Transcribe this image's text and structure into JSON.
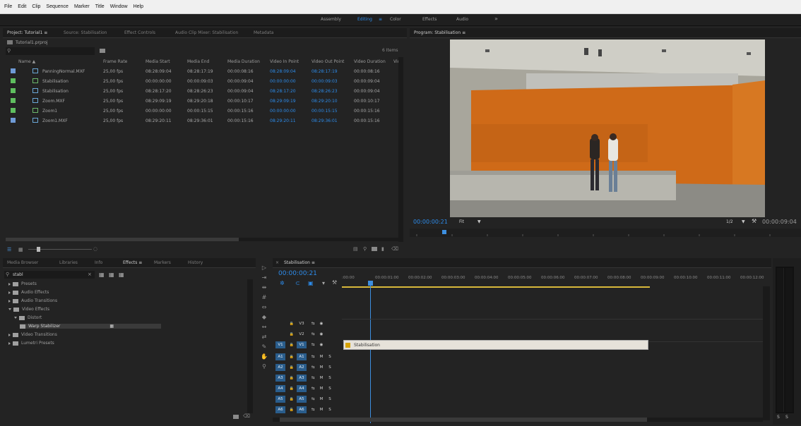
{
  "menu": [
    "File",
    "Edit",
    "Clip",
    "Sequence",
    "Marker",
    "Title",
    "Window",
    "Help"
  ],
  "workspaces": {
    "items": [
      {
        "label": "Assembly"
      },
      {
        "label": "Editing",
        "active": true
      },
      {
        "label": "≡"
      },
      {
        "label": "Color"
      },
      {
        "label": "Effects"
      },
      {
        "label": "Audio"
      },
      {
        "label": "»"
      }
    ]
  },
  "project": {
    "tabs": [
      {
        "label": "Project: Tutorial1  ≡",
        "active": true
      },
      {
        "label": "Source: Stabilisation"
      },
      {
        "label": "Effect Controls"
      },
      {
        "label": "Audio Clip Mixer: Stabilisation"
      },
      {
        "label": "Metadata"
      }
    ],
    "file": "Tutorial1.prproj",
    "item_count": "6 Items",
    "columns": [
      "Name ▲",
      "Frame Rate",
      "Media Start",
      "Media End",
      "Media Duration",
      "Video In Point",
      "Video Out Point",
      "Video Duration",
      "Vide"
    ],
    "rows": [
      {
        "name": "PanningNormal.MXF",
        "type": "seq",
        "swatch": "#6e9ad6",
        "fps": "25,00 fps",
        "start": "08:28:09:04",
        "end": "08:28:17:19",
        "dur": "00:00:08:16",
        "in": "08:28:09:04",
        "out": "08:28:17:19",
        "vdur": "00:00:08:16",
        "extra": "3"
      },
      {
        "name": "Stabilisation",
        "type": "clip",
        "swatch": "#5fbf5f",
        "fps": "25,00 fps",
        "start": "00:00:00:00",
        "end": "00:00:09:03",
        "dur": "00:00:09:04",
        "in": "00:00:00:00",
        "out": "00:00:09:03",
        "vdur": "00:00:09:04",
        "extra": "3"
      },
      {
        "name": "Stabilisation",
        "type": "seq",
        "swatch": "#5fbf5f",
        "fps": "25,00 fps",
        "start": "08:28:17:20",
        "end": "08:28:26:23",
        "dur": "00:00:09:04",
        "in": "08:28:17:20",
        "out": "08:28:26:23",
        "vdur": "00:00:09:04",
        "extra": "3"
      },
      {
        "name": "Zoom.MXF",
        "type": "seq",
        "swatch": "#5fbf5f",
        "fps": "25,00 fps",
        "start": "08:29:09:19",
        "end": "08:29:20:18",
        "dur": "00:00:10:17",
        "in": "08:29:09:19",
        "out": "08:29:20:10",
        "vdur": "00:00:10:17",
        "extra": "3"
      },
      {
        "name": "Zoom1",
        "type": "clip",
        "swatch": "#5fbf5f",
        "fps": "25,00 fps",
        "start": "00:00:00:00",
        "end": "00:00:15:15",
        "dur": "00:00:15:16",
        "in": "00:00:00:00",
        "out": "00:00:15:15",
        "vdur": "00:00:15:16",
        "extra": "3"
      },
      {
        "name": "Zoom1.MXF",
        "type": "seq",
        "swatch": "#6e9ad6",
        "fps": "25,00 fps",
        "start": "08:29:20:11",
        "end": "08:29:36:01",
        "dur": "00:00:15:16",
        "in": "08:29:20:11",
        "out": "08:29:36:01",
        "vdur": "00:00:15:16",
        "extra": "3"
      }
    ]
  },
  "program": {
    "title": "Program: Stabilisation  ≡",
    "timecode": "00:00:00:21",
    "fit": "Fit",
    "resolution": "1/2",
    "duration": "00:00:09:04"
  },
  "effects": {
    "tabs": [
      {
        "label": "Media Browser"
      },
      {
        "label": "Libraries"
      },
      {
        "label": "Info"
      },
      {
        "label": "Effects  ≡",
        "active": true
      },
      {
        "label": "Markers"
      },
      {
        "label": "History"
      }
    ],
    "search": "stabl",
    "tree": [
      {
        "label": "Presets",
        "depth": 0,
        "open": false
      },
      {
        "label": "Audio Effects",
        "depth": 0,
        "open": false
      },
      {
        "label": "Audio Transitions",
        "depth": 0,
        "open": false
      },
      {
        "label": "Video Effects",
        "depth": 0,
        "open": true
      },
      {
        "label": "Distort",
        "depth": 1,
        "open": true
      },
      {
        "label": "Warp Stabilizer",
        "depth": 2,
        "selected": true
      },
      {
        "label": "Video Transitions",
        "depth": 0,
        "open": false
      },
      {
        "label": "Lumetri Presets",
        "depth": 0,
        "open": false
      }
    ]
  },
  "timeline": {
    "tab": "Stabilisation  ≡",
    "timecode": "00:00:00:21",
    "ruler": [
      ":00:00",
      "00:00:01:00",
      "00:00:02:00",
      "00:00:03:00",
      "00:00:04:00",
      "00:00:05:00",
      "00:00:06:00",
      "00:00:07:00",
      "00:00:08:00",
      "00:00:09:00",
      "00:00:10:00",
      "00:00:11:00",
      "00:00:12:00"
    ],
    "video_tracks": [
      "V3",
      "V2",
      "V1"
    ],
    "audio_tracks": [
      "A1",
      "A2",
      "A3",
      "A4",
      "A5",
      "A6"
    ],
    "clip_label": "Stabilisation",
    "meter_labels": [
      "S",
      "S"
    ]
  }
}
